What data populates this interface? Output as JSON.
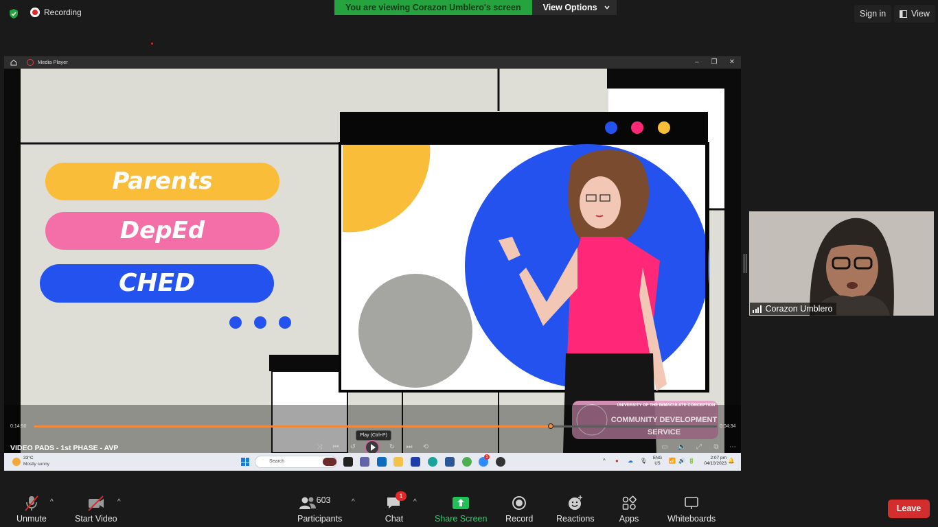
{
  "topbar": {
    "recording_label": "Recording",
    "viewing_banner": "You are viewing Corazon Umblero's screen",
    "view_options_label": "View Options",
    "sign_in_label": "Sign in",
    "view_label": "View"
  },
  "media_player": {
    "window_title": "Media Player",
    "slide": {
      "pill_1": "Parents",
      "pill_2": "DepEd",
      "pill_3": "CHED",
      "banner_line_1": "UNIVERSITY OF THE IMMACULATE CONCEPTION",
      "banner_line_2": "COMMUNITY DEVELOPMENT",
      "banner_line_3": "SERVICE",
      "colors": {
        "yellow": "#f9bd3a",
        "pink": "#f46fa8",
        "blue": "#2452ee",
        "hot_pink": "#ff2777"
      }
    },
    "elapsed_time": "0:14:50",
    "remaining_time": "0:04:34",
    "progress": 0.757,
    "media_title": "VIDEO PADS - 1st PHASE - AVP",
    "play_tooltip": "Play (Ctrl+P)"
  },
  "taskbar": {
    "weather_temp": "33°C",
    "weather_desc": "Mostly sunny",
    "search_placeholder": "Search",
    "lang_1": "ENG",
    "lang_2": "US",
    "time": "2:07 pm",
    "date": "04/10/2023",
    "badge_1": "1"
  },
  "participant_video": {
    "name": "Corazon Umblero"
  },
  "toolbar": {
    "unmute_label": "Unmute",
    "start_video_label": "Start Video",
    "participants_label": "Participants",
    "participants_count": "603",
    "chat_label": "Chat",
    "chat_badge": "1",
    "share_screen_label": "Share Screen",
    "record_label": "Record",
    "reactions_label": "Reactions",
    "apps_label": "Apps",
    "whiteboards_label": "Whiteboards",
    "leave_label": "Leave"
  }
}
